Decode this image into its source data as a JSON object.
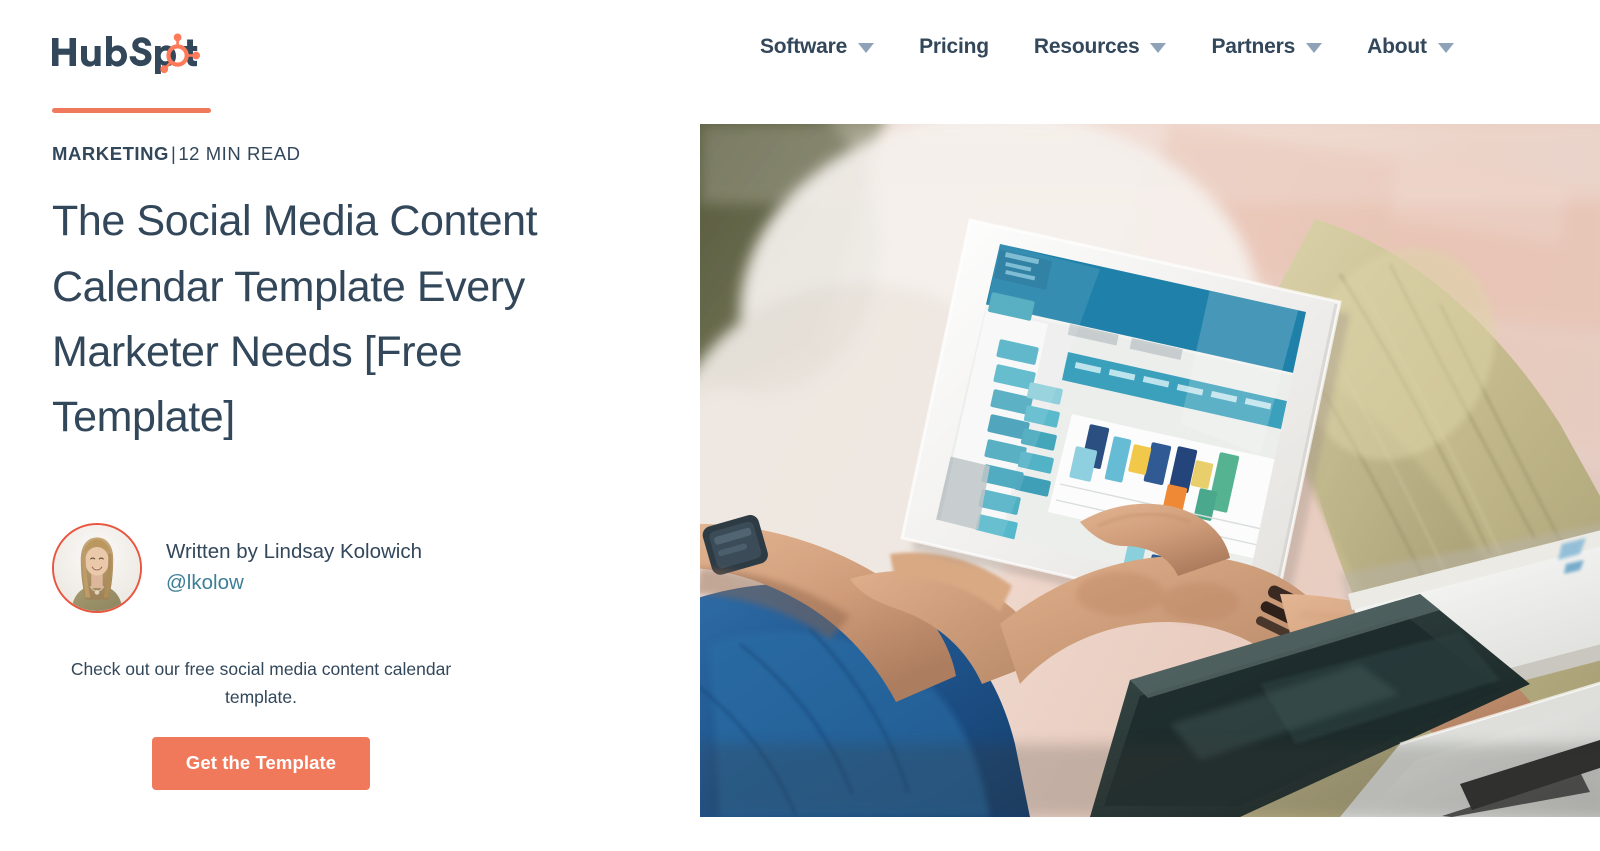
{
  "brand": {
    "logo_text": "HubSpot",
    "accent_color": "#f0795b",
    "logo_dark_color": "#33475b",
    "logo_sprocket_color": "#ff7a59"
  },
  "nav": {
    "items": [
      {
        "label": "Software",
        "has_dropdown": true,
        "icon": "chevron-down-icon"
      },
      {
        "label": "Pricing",
        "has_dropdown": false,
        "icon": ""
      },
      {
        "label": "Resources",
        "has_dropdown": true,
        "icon": "chevron-down-icon"
      },
      {
        "label": "Partners",
        "has_dropdown": true,
        "icon": "chevron-down-icon"
      },
      {
        "label": "About",
        "has_dropdown": true,
        "icon": "chevron-down-icon"
      }
    ]
  },
  "article": {
    "category": "MARKETING",
    "separator": "|",
    "read_time": "12 MIN READ",
    "title": "The Social Media Content Calendar Template Every Marketer Needs [Free Template]"
  },
  "author": {
    "byline": "Written by Lindsay Kolowich",
    "handle": "@lkolow",
    "avatar_name": "lindsay-kolowich-avatar",
    "avatar_ring_color": "#e8563f",
    "handle_color": "#3d7f96"
  },
  "cta": {
    "text": "Check out our free social media content calendar template.",
    "button_label": "Get the Template",
    "button_color": "#f0795b"
  },
  "hero": {
    "alt": "Person sitting on the floor holding a tablet displaying a colorful content calendar spreadsheet, with a notebook and laptop nearby",
    "background_color": "#e9d9d2"
  }
}
